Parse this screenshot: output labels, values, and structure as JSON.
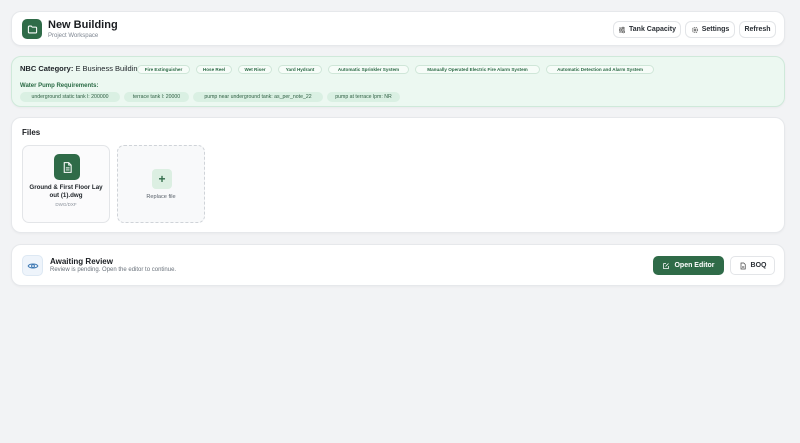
{
  "header": {
    "title": "New Building",
    "subtitle": "Project Workspace",
    "tank_capacity_label": "Tank Capacity",
    "settings_label": "Settings",
    "refresh_label": "Refresh"
  },
  "nbc": {
    "category_label": "NBC Category:",
    "category_value": "E Business Building",
    "tags": [
      "Fire Extinguisher",
      "Hose Reel",
      "Wet Riser",
      "Yard Hydrant",
      "Automatic Sprinkler System",
      "Manually Operated Electric Fire Alarm System",
      "Automatic Detection and Alarm System"
    ],
    "water_pump_label": "Water Pump Requirements:",
    "requirements": [
      "underground static tank l: 200000",
      "terrace tank l: 20000",
      "pump near underground tank: as_per_note_22",
      "pump at terrace lpm: NR"
    ]
  },
  "files": {
    "title": "Files",
    "file_name": "Ground & First Floor Lay out (1).dwg",
    "file_type": "DWG/DXF",
    "replace_label": "Replace file"
  },
  "review": {
    "title": "Awaiting Review",
    "subtitle": "Review is pending. Open the editor to continue.",
    "open_editor_label": "Open Editor",
    "boq_label": "BOQ"
  },
  "colors": {
    "brand_green": "#2f6b48",
    "nbc_background": "#ecf8f1",
    "page_background": "#f2f3f5"
  }
}
